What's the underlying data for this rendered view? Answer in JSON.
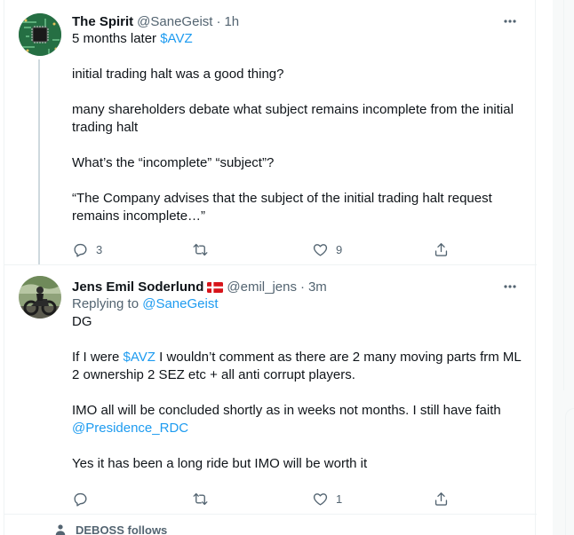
{
  "tweets": [
    {
      "name": "The Spirit",
      "handle": "@SaneGeist",
      "separator": "·",
      "time": "1h",
      "more": "•••",
      "line1_prefix": "5 months later ",
      "line1_cashtag": "$AVZ",
      "p2": "initial trading halt was a good thing?",
      "p3a": "many shareholders debate what subject remains incomplete from the initial",
      "p3b": "trading halt",
      "p4": "What’s the “incomplete” “subject”?",
      "p5a": "“The Company advises that the subject of the initial trading halt request",
      "p5b": "remains incomplete…”",
      "replies": "3",
      "retweets": "",
      "likes": "9"
    },
    {
      "name": "Jens Emil Soderlund",
      "flag": "Denmark flag",
      "handle": "@emil_jens",
      "separator": "·",
      "time": "3m",
      "more": "•••",
      "replying_prefix": "Replying to ",
      "replying_to": "@SaneGeist",
      "p1": "DG",
      "p2_prefix": "If I were ",
      "p2_cashtag": "$AVZ",
      "p2_rest": " I wouldn’t comment as there are 2 many moving parts frm ML",
      "p2b": "2 ownership 2 SEZ etc + all anti corrupt players.",
      "p3a": "IMO all will be concluded shortly as in weeks not months. I still have faith",
      "p3_mention": "@Presidence_RDC",
      "p4": "Yes it has been a long ride but IMO will be worth it",
      "replies": "",
      "retweets": "",
      "likes": "1"
    }
  ],
  "social_context": {
    "label": "DEBOSS follows",
    "icon": "person-icon"
  },
  "colors": {
    "link": "#1d9bf0",
    "muted": "#536471",
    "text": "#0f1419",
    "border": "#eff3f4"
  }
}
